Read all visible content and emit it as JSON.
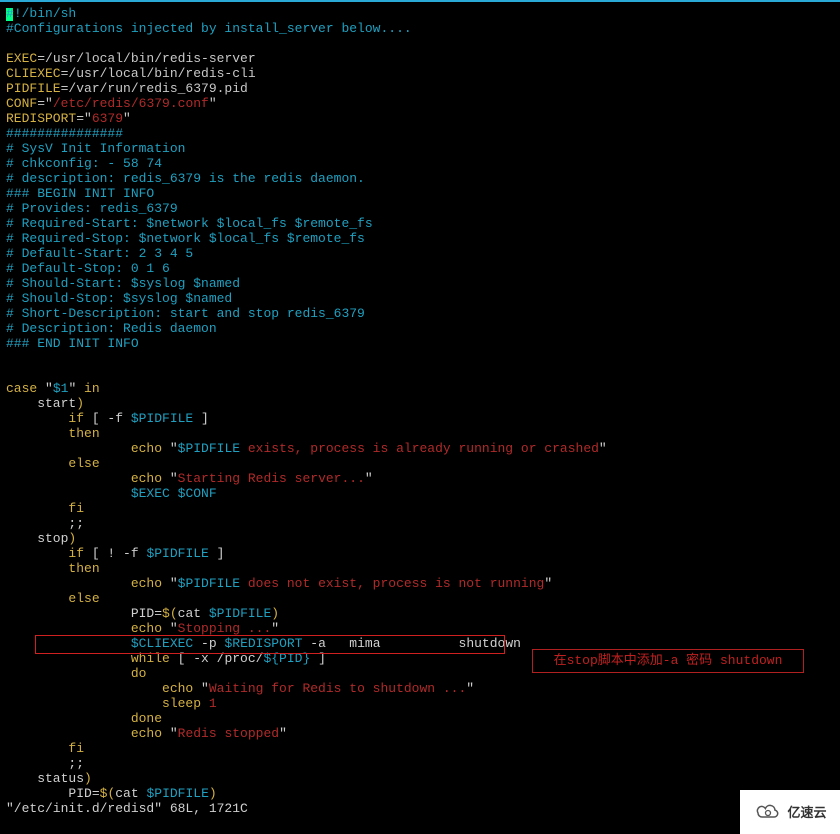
{
  "lines": {
    "l01a": "#",
    "l01b": "!/bin/sh",
    "l02": "#Configurations injected by install_server below....",
    "l03_a": "EXEC",
    "l03_b": "=/usr/local/bin/redis-server",
    "l04_a": "CLIEXEC",
    "l04_b": "=/usr/local/bin/redis-cli",
    "l05_a": "PIDFILE",
    "l05_b": "=/var/run/redis_6379.pid",
    "l06_a": "CONF",
    "l06_b": "=\"",
    "l06_c": "/etc/redis/6379.conf",
    "l06_d": "\"",
    "l07_a": "REDISPORT",
    "l07_b": "=\"",
    "l07_c": "6379",
    "l07_d": "\"",
    "l08": "###############",
    "l09": "# SysV Init Information",
    "l10": "# chkconfig: - 58 74",
    "l11": "# description: redis_6379 is the redis daemon.",
    "l12": "### BEGIN INIT INFO",
    "l13": "# Provides: redis_6379",
    "l14": "# Required-Start: $network $local_fs $remote_fs",
    "l15": "# Required-Stop: $network $local_fs $remote_fs",
    "l16": "# Default-Start: 2 3 4 5",
    "l17": "# Default-Stop: 0 1 6",
    "l18": "# Should-Start: $syslog $named",
    "l19": "# Should-Stop: $syslog $named",
    "l20": "# Short-Description: start and stop redis_6379",
    "l21": "# Description: Redis daemon",
    "l22": "### END INIT INFO",
    "l23_a": "case",
    "l23_b": " \"",
    "l23_c": "$1",
    "l23_d": "\" ",
    "l23_e": "in",
    "l24_a": "    start",
    "l24_b": ")",
    "l25_a": "        if",
    "l25_b": " [ -f ",
    "l25_c": "$PIDFILE",
    "l25_d": " ]",
    "l26": "        then",
    "l27_a": "                echo",
    "l27_b": " \"",
    "l27_c": "$PIDFILE",
    "l27_d": " exists, process is already running or crashed",
    "l27_e": "\"",
    "l28": "        else",
    "l29_a": "                echo",
    "l29_b": " \"",
    "l29_c": "Starting Redis server...",
    "l29_d": "\"",
    "l30_a": "                ",
    "l30_b": "$EXEC",
    "l30_c": " ",
    "l30_d": "$CONF",
    "l31": "        fi",
    "l32": "        ;;",
    "l33_a": "    stop",
    "l33_b": ")",
    "l34_a": "        if",
    "l34_b": " [ ! -f ",
    "l34_c": "$PIDFILE",
    "l34_d": " ]",
    "l35": "        then",
    "l36_a": "                echo",
    "l36_b": " \"",
    "l36_c": "$PIDFILE",
    "l36_d": " does not exist, process is not running",
    "l36_e": "\"",
    "l37": "        else",
    "l38_a": "                PID",
    "l38_b": "=",
    "l38_c": "$(",
    "l38_d": "cat ",
    "l38_e": "$PIDFILE",
    "l38_f": ")",
    "l39_a": "                echo",
    "l39_b": " \"",
    "l39_c": "Stopping ...",
    "l39_d": "\"",
    "l40_a": "                ",
    "l40_b": "$CLIEXEC",
    "l40_c": " -p ",
    "l40_d": "$REDISPORT",
    "l40_e": " -a",
    "l40_f": "   mima          shutdown",
    "l41_a": "                while",
    "l41_b": " [ -x ",
    "l41_c": "/proc/",
    "l41_d": "${PID}",
    "l41_e": " ]",
    "l42": "                do",
    "l43_a": "                    echo",
    "l43_b": " \"",
    "l43_c": "Waiting for Redis to shutdown ...",
    "l43_d": "\"",
    "l44_a": "                    sleep",
    "l44_b": " ",
    "l44_c": "1",
    "l45": "                done",
    "l46_a": "                echo",
    "l46_b": " \"",
    "l46_c": "Redis stopped",
    "l46_d": "\"",
    "l47": "        fi",
    "l48": "        ;;",
    "l49_a": "    status",
    "l49_b": ")",
    "l50_a": "        PID",
    "l50_b": "=",
    "l50_c": "$(",
    "l50_d": "cat ",
    "l50_e": "$PIDFILE",
    "l50_f": ")"
  },
  "status": "\"/etc/init.d/redisd\" 68L, 1721C",
  "note": {
    "prefix": "在stop脚本中添加-a 密码 ",
    "kw": "shutdown"
  },
  "logo_text": "亿速云"
}
